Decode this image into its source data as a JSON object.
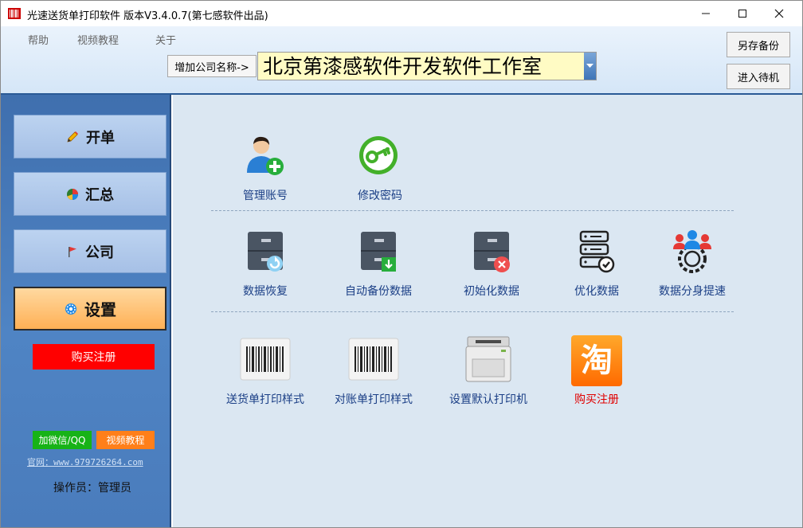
{
  "window": {
    "title": "光速送货单打印软件 版本V3.4.0.7(第七感软件出品)",
    "controls": {
      "minimize": "—",
      "maximize": "☐",
      "close": "✕"
    }
  },
  "menu": [
    "帮助",
    "视频教程",
    "关于"
  ],
  "company": {
    "add_label": "增加公司名称->",
    "selected": "北京第漆感软件开发软件工作室"
  },
  "header_buttons": {
    "backup": "另存备份",
    "standby": "进入待机"
  },
  "sidebar": {
    "nav": [
      {
        "label": "开单",
        "icon": "pencil-icon"
      },
      {
        "label": "汇总",
        "icon": "pie-chart-icon"
      },
      {
        "label": "公司",
        "icon": "flag-icon"
      },
      {
        "label": "设置",
        "icon": "gear-icon",
        "active": true
      }
    ],
    "buy_register": "购买注册",
    "wechat_qq": "加微信/QQ",
    "video_tutorial": "视频教程",
    "website": "官网：www.979726264.com",
    "operator": "操作员：管理员"
  },
  "settings": {
    "account": [
      {
        "label": "管理账号",
        "icon": "user-add-icon"
      },
      {
        "label": "修改密码",
        "icon": "key-icon"
      }
    ],
    "data": [
      {
        "label": "数据恢复",
        "icon": "cabinet-restore-icon"
      },
      {
        "label": "自动备份数据",
        "icon": "cabinet-backup-icon"
      },
      {
        "label": "初始化数据",
        "icon": "cabinet-delete-icon"
      },
      {
        "label": "优化数据",
        "icon": "database-optimize-icon"
      },
      {
        "label": "数据分身提速",
        "icon": "team-gear-icon"
      }
    ],
    "print": [
      {
        "label": "送货单打印样式",
        "icon": "barcode-icon"
      },
      {
        "label": "对账单打印样式",
        "icon": "barcode-icon"
      },
      {
        "label": "设置默认打印机",
        "icon": "printer-icon"
      },
      {
        "label": "购买注册",
        "icon": "taobao-icon",
        "glyph": "淘"
      }
    ]
  },
  "colors": {
    "accent": "#2a5a96",
    "active_nav": "#ffb055",
    "buy": "#ff0000",
    "link": "#1b3f86"
  }
}
